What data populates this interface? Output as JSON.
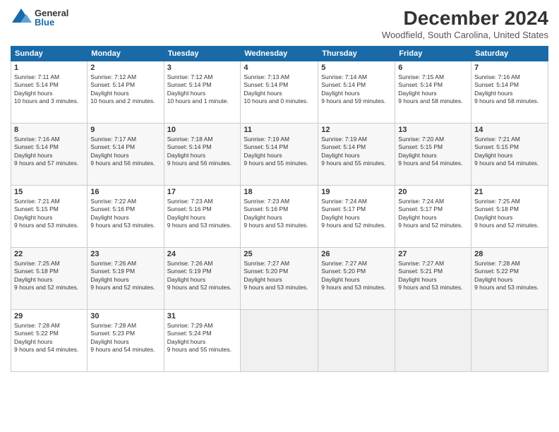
{
  "logo": {
    "general": "General",
    "blue": "Blue"
  },
  "title": "December 2024",
  "location": "Woodfield, South Carolina, United States",
  "headers": [
    "Sunday",
    "Monday",
    "Tuesday",
    "Wednesday",
    "Thursday",
    "Friday",
    "Saturday"
  ],
  "weeks": [
    [
      {
        "day": "1",
        "rise": "7:11 AM",
        "set": "5:14 PM",
        "daylight": "10 hours and 3 minutes."
      },
      {
        "day": "2",
        "rise": "7:12 AM",
        "set": "5:14 PM",
        "daylight": "10 hours and 2 minutes."
      },
      {
        "day": "3",
        "rise": "7:12 AM",
        "set": "5:14 PM",
        "daylight": "10 hours and 1 minute."
      },
      {
        "day": "4",
        "rise": "7:13 AM",
        "set": "5:14 PM",
        "daylight": "10 hours and 0 minutes."
      },
      {
        "day": "5",
        "rise": "7:14 AM",
        "set": "5:14 PM",
        "daylight": "9 hours and 59 minutes."
      },
      {
        "day": "6",
        "rise": "7:15 AM",
        "set": "5:14 PM",
        "daylight": "9 hours and 58 minutes."
      },
      {
        "day": "7",
        "rise": "7:16 AM",
        "set": "5:14 PM",
        "daylight": "9 hours and 58 minutes."
      }
    ],
    [
      {
        "day": "8",
        "rise": "7:16 AM",
        "set": "5:14 PM",
        "daylight": "9 hours and 57 minutes."
      },
      {
        "day": "9",
        "rise": "7:17 AM",
        "set": "5:14 PM",
        "daylight": "9 hours and 56 minutes."
      },
      {
        "day": "10",
        "rise": "7:18 AM",
        "set": "5:14 PM",
        "daylight": "9 hours and 56 minutes."
      },
      {
        "day": "11",
        "rise": "7:19 AM",
        "set": "5:14 PM",
        "daylight": "9 hours and 55 minutes."
      },
      {
        "day": "12",
        "rise": "7:19 AM",
        "set": "5:14 PM",
        "daylight": "9 hours and 55 minutes."
      },
      {
        "day": "13",
        "rise": "7:20 AM",
        "set": "5:15 PM",
        "daylight": "9 hours and 54 minutes."
      },
      {
        "day": "14",
        "rise": "7:21 AM",
        "set": "5:15 PM",
        "daylight": "9 hours and 54 minutes."
      }
    ],
    [
      {
        "day": "15",
        "rise": "7:21 AM",
        "set": "5:15 PM",
        "daylight": "9 hours and 53 minutes."
      },
      {
        "day": "16",
        "rise": "7:22 AM",
        "set": "5:16 PM",
        "daylight": "9 hours and 53 minutes."
      },
      {
        "day": "17",
        "rise": "7:23 AM",
        "set": "5:16 PM",
        "daylight": "9 hours and 53 minutes."
      },
      {
        "day": "18",
        "rise": "7:23 AM",
        "set": "5:16 PM",
        "daylight": "9 hours and 53 minutes."
      },
      {
        "day": "19",
        "rise": "7:24 AM",
        "set": "5:17 PM",
        "daylight": "9 hours and 52 minutes."
      },
      {
        "day": "20",
        "rise": "7:24 AM",
        "set": "5:17 PM",
        "daylight": "9 hours and 52 minutes."
      },
      {
        "day": "21",
        "rise": "7:25 AM",
        "set": "5:18 PM",
        "daylight": "9 hours and 52 minutes."
      }
    ],
    [
      {
        "day": "22",
        "rise": "7:25 AM",
        "set": "5:18 PM",
        "daylight": "9 hours and 52 minutes."
      },
      {
        "day": "23",
        "rise": "7:26 AM",
        "set": "5:19 PM",
        "daylight": "9 hours and 52 minutes."
      },
      {
        "day": "24",
        "rise": "7:26 AM",
        "set": "5:19 PM",
        "daylight": "9 hours and 52 minutes."
      },
      {
        "day": "25",
        "rise": "7:27 AM",
        "set": "5:20 PM",
        "daylight": "9 hours and 53 minutes."
      },
      {
        "day": "26",
        "rise": "7:27 AM",
        "set": "5:20 PM",
        "daylight": "9 hours and 53 minutes."
      },
      {
        "day": "27",
        "rise": "7:27 AM",
        "set": "5:21 PM",
        "daylight": "9 hours and 53 minutes."
      },
      {
        "day": "28",
        "rise": "7:28 AM",
        "set": "5:22 PM",
        "daylight": "9 hours and 53 minutes."
      }
    ],
    [
      {
        "day": "29",
        "rise": "7:28 AM",
        "set": "5:22 PM",
        "daylight": "9 hours and 54 minutes."
      },
      {
        "day": "30",
        "rise": "7:28 AM",
        "set": "5:23 PM",
        "daylight": "9 hours and 54 minutes."
      },
      {
        "day": "31",
        "rise": "7:29 AM",
        "set": "5:24 PM",
        "daylight": "9 hours and 55 minutes."
      },
      null,
      null,
      null,
      null
    ]
  ]
}
